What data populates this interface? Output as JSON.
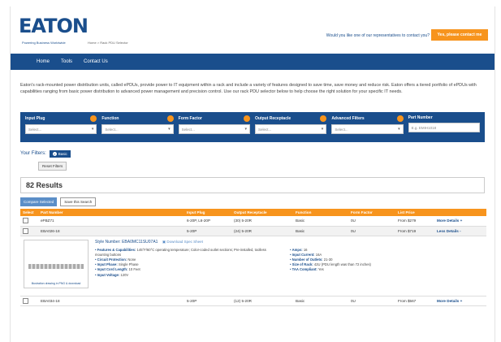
{
  "header": {
    "logo": "EATON",
    "tagline": "Powering Business Worldwide",
    "page_subtitle": "Home > Rack PDU Selector",
    "cta_question": "Would you like one of our representatives to contact you?",
    "cta_button": "Yes, please contact me"
  },
  "nav": [
    "Home",
    "Tools",
    "Contact Us"
  ],
  "intro": "Eaton's rack-mounted power distribution units, called ePDUs, provide power to IT equipment within a rack and include a variety of features designed to save time, save money and reduce risk. Eaton offers a tiered portfolio of ePDUs with capabilities ranging from basic power distribution to advanced power management and precision control. Use our rack PDU selector below to help choose the right solution for your specific IT needs.",
  "filters": [
    {
      "label": "Input Plug",
      "value": "Select..."
    },
    {
      "label": "Function",
      "value": "Select..."
    },
    {
      "label": "Form Factor",
      "value": "Select..."
    },
    {
      "label": "Output Receptacle",
      "value": "Select..."
    },
    {
      "label": "Advanced Filters",
      "value": "Select..."
    },
    {
      "label": "Part Number",
      "value": "E.g. EMIH1018"
    }
  ],
  "your_filters": {
    "label": "Your Filters:",
    "tag": "Basic",
    "reset": "Reset Filters"
  },
  "results": "82 Results",
  "actions": {
    "compare": "Compare Selected",
    "save": "Save this Search"
  },
  "columns": [
    "Select",
    "Part Number",
    "Input Plug",
    "Output Receptacle",
    "Function",
    "Form Factor",
    "List Price",
    ""
  ],
  "rows": [
    {
      "part": "ePBZ71",
      "plug": "6-20P, L6-20P",
      "output": "(30) 5-20R",
      "function": "Basic",
      "form": "0U",
      "price": "From $279",
      "more": "More Details +"
    },
    {
      "part": "EBA026-18",
      "plug": "5-20P",
      "output": "(24) 5-20R",
      "function": "Basic",
      "form": "0U",
      "price": "From $719",
      "more": "Less Details -"
    },
    {
      "part": "EBA034-18",
      "plug": "5-20P",
      "output": "(12) 5-20R",
      "function": "Basic",
      "form": "0U",
      "price": "From $567",
      "more": "More Details +"
    }
  ],
  "detail": {
    "style": "Style Number: EBA0MC11SU07A1",
    "download": "Download Spec Sheet",
    "thumb_caption": "Illustration drawing in PNG & download",
    "left": [
      {
        "k": "Features & Capabilities:",
        "v": "145°F/60°C operating temperature; Color-coded outlet sections; Pre-installed, toolless mounting buttons"
      },
      {
        "k": "Circuit Protection:",
        "v": "None"
      },
      {
        "k": "Input Phase:",
        "v": "Single Phase"
      },
      {
        "k": "Input Cord Length:",
        "v": "10 Feet"
      },
      {
        "k": "Input Voltage:",
        "v": "120V"
      }
    ],
    "right": [
      {
        "k": "Amps:",
        "v": "16"
      },
      {
        "k": "Input Current:",
        "v": "16A"
      },
      {
        "k": "Number of Outlets:",
        "v": "21-30"
      },
      {
        "k": "Size of Rack:",
        "v": "42U (PDU length was than 72 inches)"
      },
      {
        "k": "TAA Compliant:",
        "v": "Yes"
      }
    ]
  },
  "colors": {
    "brand_blue": "#1a4e8c",
    "accent_orange": "#f7941d"
  }
}
